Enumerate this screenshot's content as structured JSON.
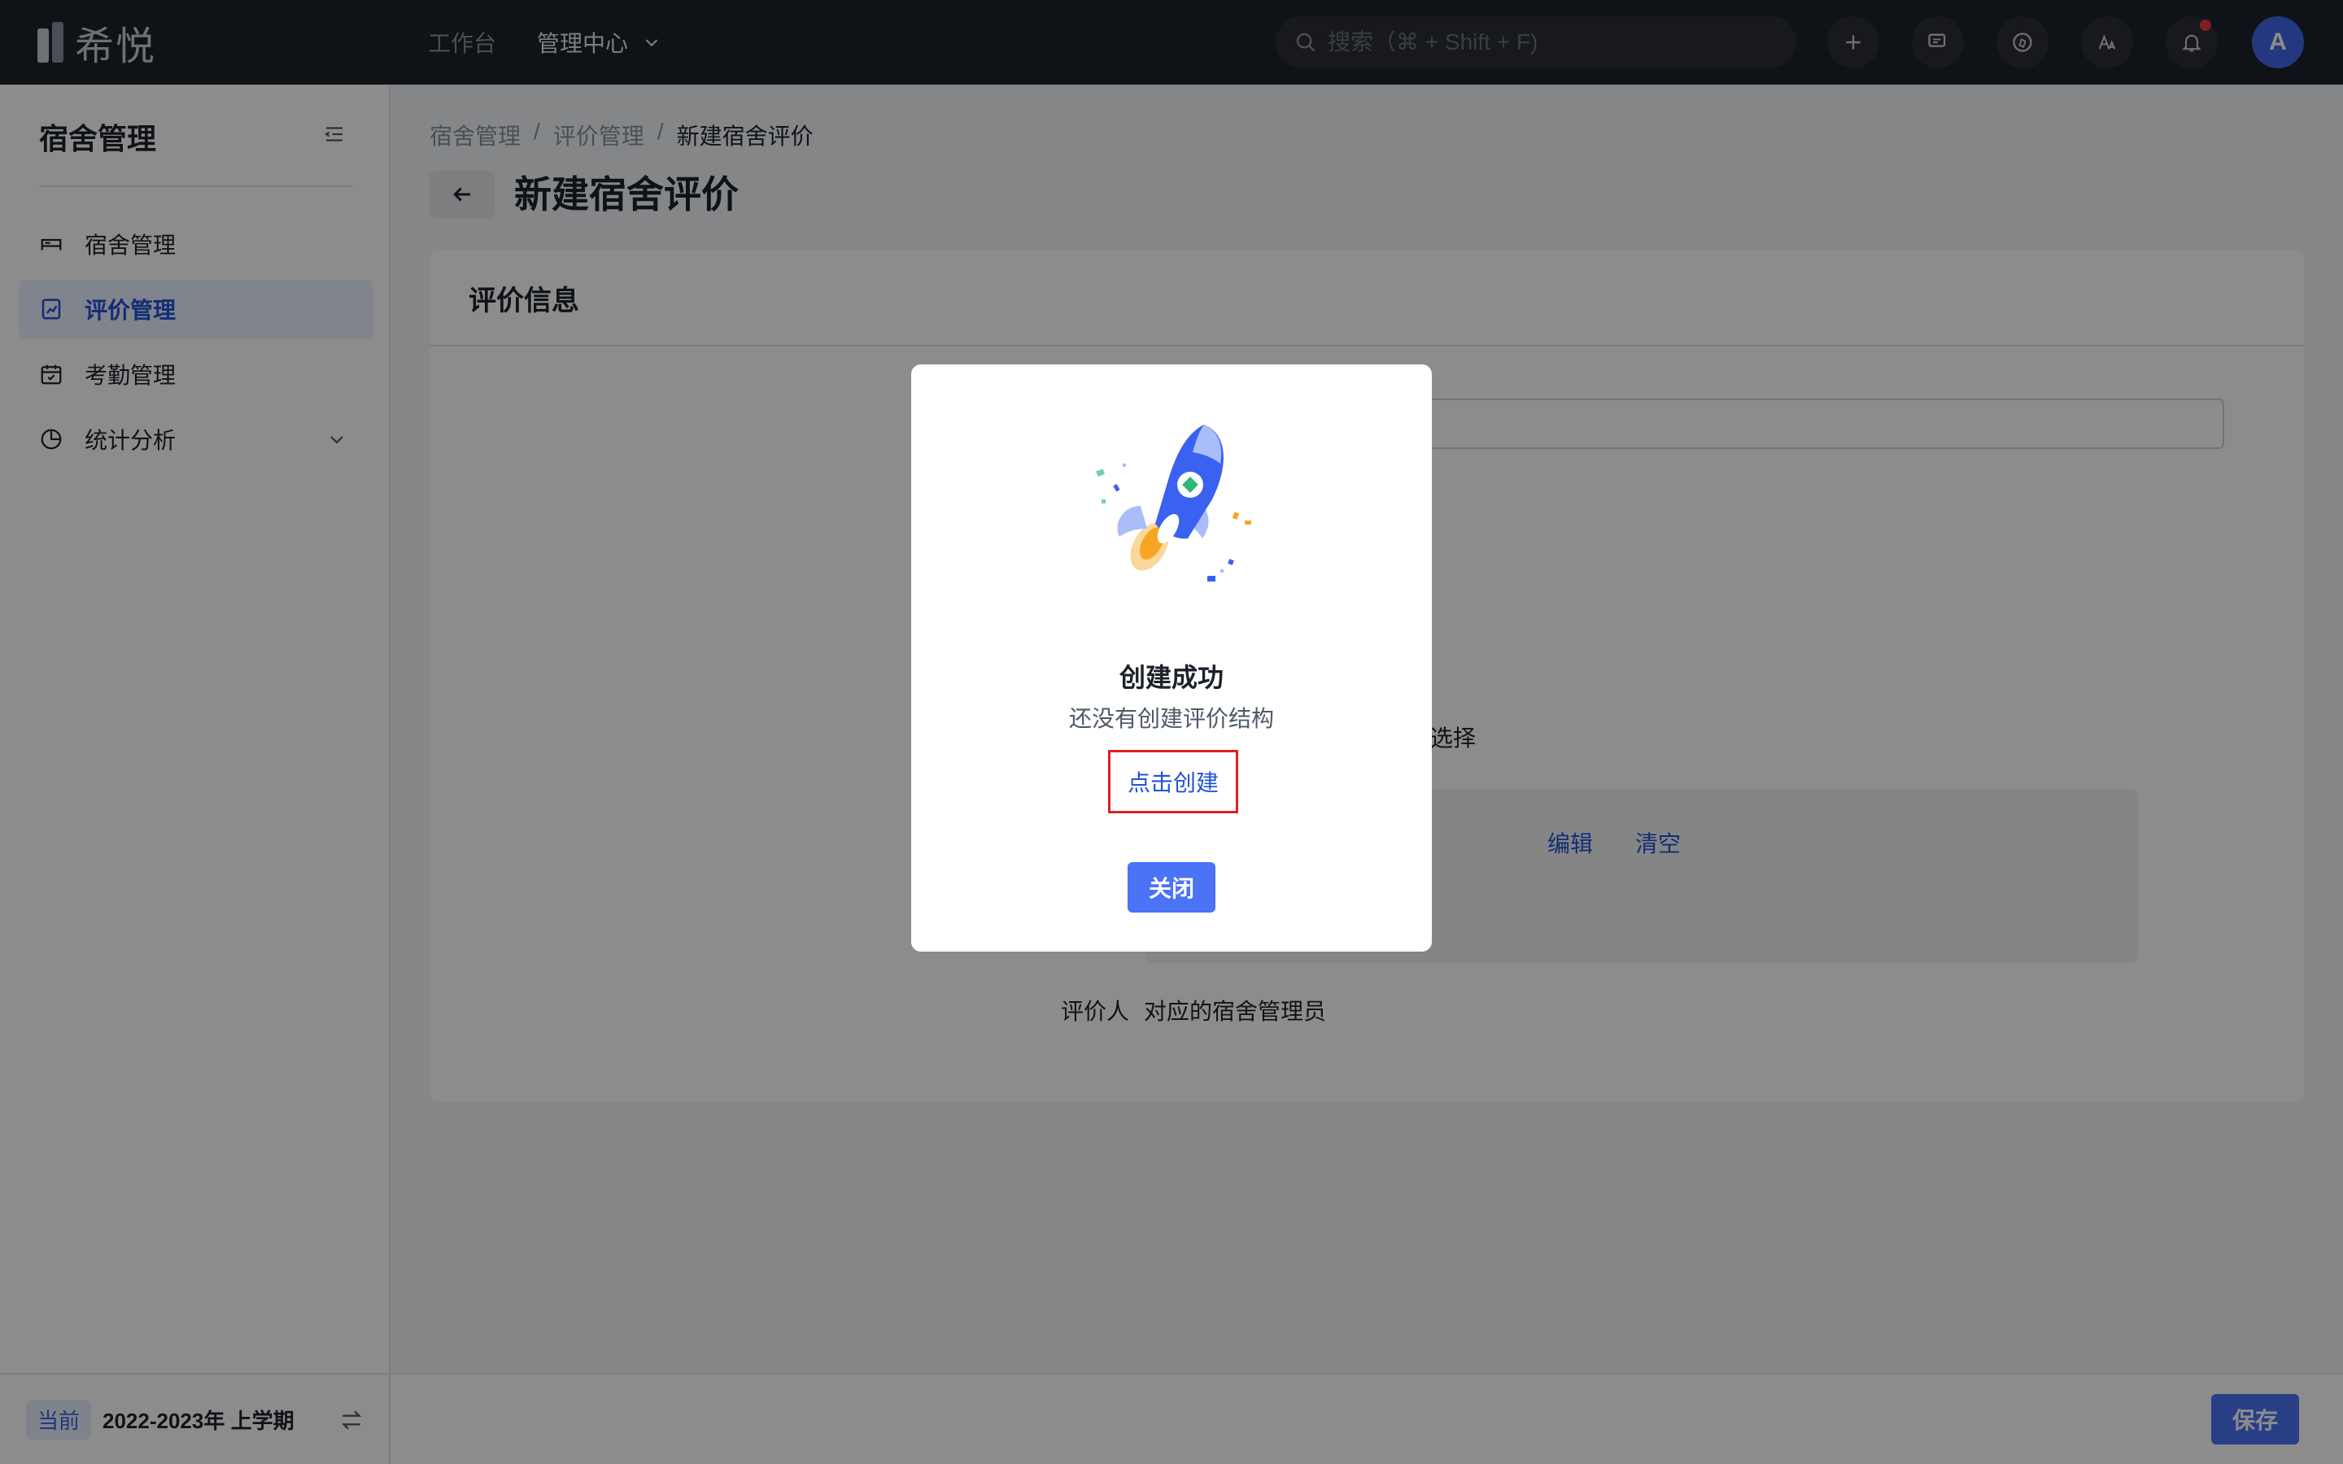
{
  "app": {
    "logo_text": "希悦"
  },
  "topnav": {
    "items": [
      {
        "label": "工作台"
      },
      {
        "label": "管理中心"
      }
    ]
  },
  "search": {
    "placeholder": "搜索（⌘ + Shift + F)"
  },
  "user": {
    "avatar_initial": "A"
  },
  "sidebar": {
    "title": "宿舍管理",
    "items": [
      {
        "label": "宿舍管理",
        "icon": "bed-icon"
      },
      {
        "label": "评价管理",
        "icon": "chart-doc-icon",
        "active": true
      },
      {
        "label": "考勤管理",
        "icon": "calendar-check-icon"
      },
      {
        "label": "统计分析",
        "icon": "pie-chart-icon"
      }
    ],
    "footer": {
      "tag": "当前",
      "term": "2022-2023年 上学期"
    }
  },
  "breadcrumb": {
    "items": [
      "宿舍管理",
      "评价管理",
      "新建宿舍评价"
    ],
    "separator": "/"
  },
  "page": {
    "title": "新建宿舍评价"
  },
  "card": {
    "title": "评价信息",
    "select_hint": "选择",
    "edit_link": "编辑",
    "clear_link": "清空",
    "evaluator_label": "评价人",
    "evaluator_value": "对应的宿舍管理员"
  },
  "footer": {
    "save_label": "保存"
  },
  "modal": {
    "title": "创建成功",
    "subtitle": "还没有创建评价结构",
    "create_link": "点击创建",
    "close_label": "关闭"
  },
  "colors": {
    "topbar": "#1d2129",
    "accent": "#4a73f5",
    "link": "#2453d6",
    "highlight_border": "#e02020"
  }
}
